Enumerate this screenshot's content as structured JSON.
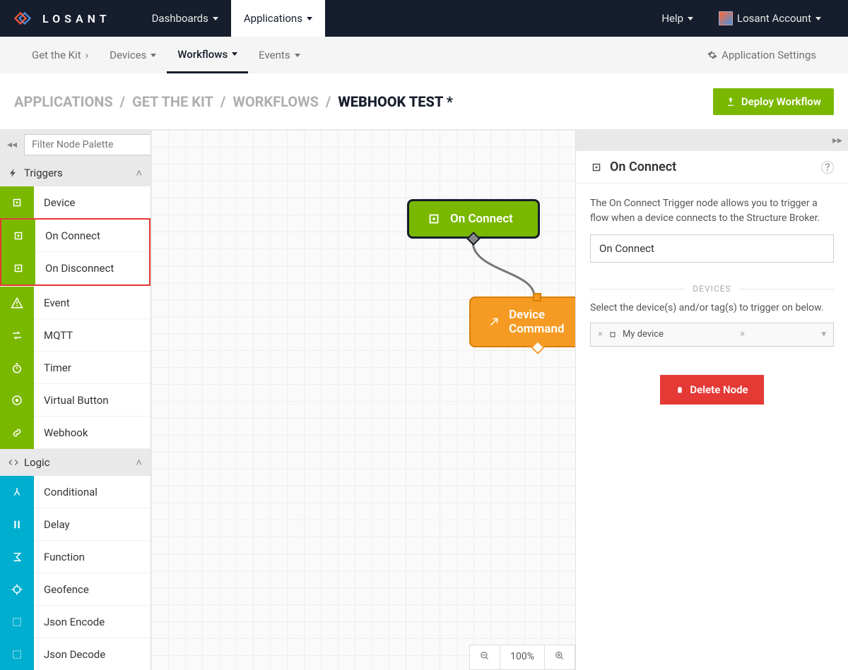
{
  "brand": "LOSANT",
  "topnav": {
    "dashboards": "Dashboards",
    "applications": "Applications",
    "help": "Help",
    "account": "Losant Account"
  },
  "subnav": {
    "getKit": "Get the Kit",
    "devices": "Devices",
    "workflows": "Workflows",
    "events": "Events",
    "settings": "Application Settings"
  },
  "breadcrumb": {
    "applications": "APPLICATIONS",
    "getKit": "GET THE KIT",
    "workflows": "WORKFLOWS",
    "current": "WEBHOOK TEST *"
  },
  "deploy": "Deploy Workflow",
  "palette": {
    "filterPlaceholder": "Filter Node Palette",
    "collapse": "◂◂",
    "triggers": {
      "title": "Triggers",
      "device": "Device",
      "onConnect": "On Connect",
      "onDisconnect": "On Disconnect",
      "event": "Event",
      "mqtt": "MQTT",
      "timer": "Timer",
      "virtualButton": "Virtual Button",
      "webhook": "Webhook"
    },
    "logic": {
      "title": "Logic",
      "conditional": "Conditional",
      "delay": "Delay",
      "function": "Function",
      "geofence": "Geofence",
      "jsonEncode": "Json Encode",
      "jsonDecode": "Json Decode"
    }
  },
  "canvas": {
    "nodeTrigger": "On Connect",
    "nodeOutput": "Device Command",
    "zoom": "100%"
  },
  "inspector": {
    "title": "On Connect",
    "description": "The On Connect Trigger node allows you to trigger a flow when a device connects to the Structure Broker.",
    "nameValue": "On Connect",
    "devicesLabel": "DEVICES",
    "devicesHelp": "Select the device(s) and/or tag(s) to trigger on below.",
    "selectedDevice": "My device",
    "delete": "Delete Node",
    "expand": "▸▸"
  }
}
